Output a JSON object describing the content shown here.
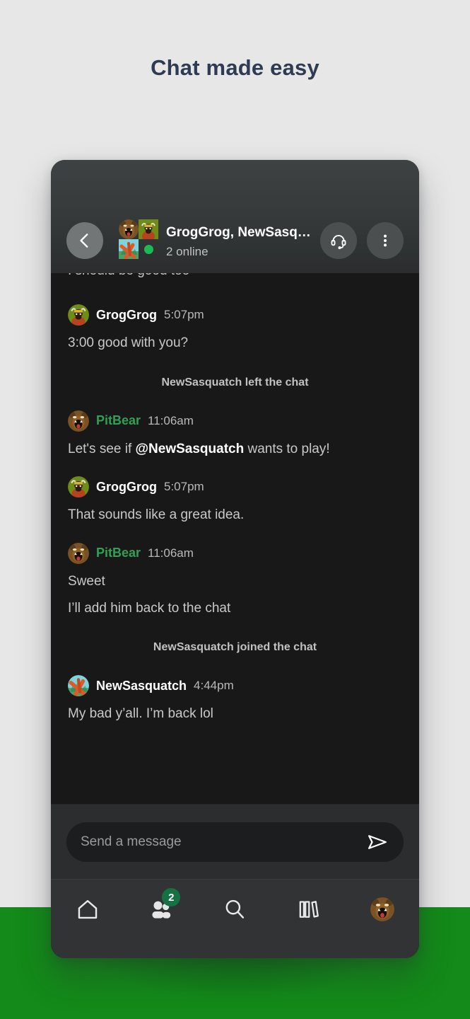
{
  "hero": {
    "title": "Chat made easy"
  },
  "colors": {
    "page_bg": "#e7e7e7",
    "band_green": "#138a19",
    "title": "#2e3b52",
    "header_bg": "#35393a",
    "chat_bg": "#181818",
    "accent_green": "#31a055",
    "badge_green": "#177243",
    "online_dot": "#1db954"
  },
  "chat_header": {
    "back_icon": "chevron-left-icon",
    "title": "GrogGrog, NewSasq…",
    "subtitle": "2 online",
    "call_icon": "headset-icon",
    "menu_icon": "more-vertical-icon",
    "avatars": [
      "PitBear",
      "GrogGrog",
      "NewSasquatch"
    ]
  },
  "messages": {
    "clipped_top": "I should be good too",
    "items": [
      {
        "type": "message",
        "user": "GrogGrog",
        "user_color": "white",
        "time": "5:07pm",
        "avatar": "groggrog-avatar",
        "lines": [
          "3:00 good with you?"
        ]
      },
      {
        "type": "system",
        "text": "NewSasquatch left the chat"
      },
      {
        "type": "message",
        "user": "PitBear",
        "user_color": "green",
        "time": "11:06am",
        "avatar": "pitbear-avatar",
        "lines": [
          "Let's see if ",
          "@NewSasquatch",
          " wants to play!"
        ],
        "has_mention": true,
        "prefix": "Let's see if ",
        "mention": "@NewSasquatch",
        "suffix": " wants to play!"
      },
      {
        "type": "message",
        "user": "GrogGrog",
        "user_color": "white",
        "time": "5:07pm",
        "avatar": "groggrog-avatar",
        "lines": [
          "That sounds like a great idea."
        ]
      },
      {
        "type": "message",
        "user": "PitBear",
        "user_color": "green",
        "time": "11:06am",
        "avatar": "pitbear-avatar",
        "lines": [
          "Sweet",
          "I’ll add him back to the chat"
        ]
      },
      {
        "type": "system",
        "text": "NewSasquatch joined the chat"
      },
      {
        "type": "message",
        "user": "NewSasquatch",
        "user_color": "white",
        "time": "4:44pm",
        "avatar": "newsasquatch-avatar",
        "lines": [
          "My bad y’all. I’m back lol"
        ]
      }
    ]
  },
  "composer": {
    "placeholder": "Send a message",
    "value": "",
    "send_icon": "send-paper-plane-icon"
  },
  "bottom_nav": {
    "items": [
      {
        "name": "home",
        "icon": "home-icon",
        "badge": ""
      },
      {
        "name": "friends",
        "icon": "people-icon",
        "badge": "2"
      },
      {
        "name": "search",
        "icon": "search-icon",
        "badge": ""
      },
      {
        "name": "library",
        "icon": "library-books-icon",
        "badge": ""
      },
      {
        "name": "profile",
        "icon": "profile-avatar-icon",
        "badge": ""
      }
    ]
  }
}
